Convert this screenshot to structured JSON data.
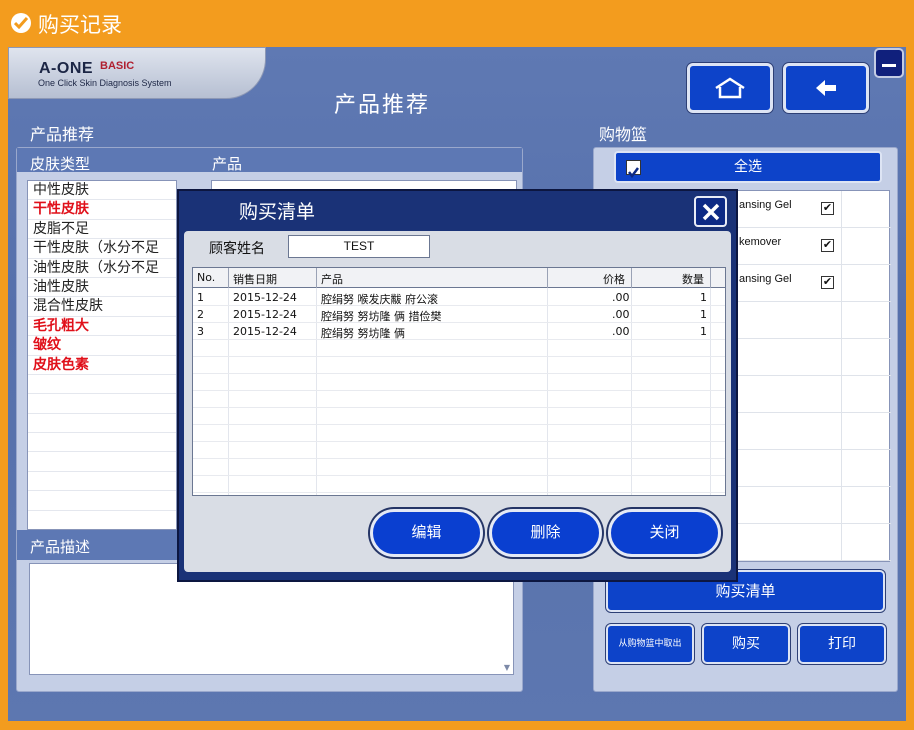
{
  "window": {
    "title": "购买记录"
  },
  "logo": {
    "main": "A-ONE",
    "basic": "BASIC",
    "sub": "One Click Skin Diagnosis System"
  },
  "page_title": "产品推荐",
  "left_panel": {
    "section_title": "产品推荐",
    "skin_type_header": "皮肤类型",
    "product_header": "产品",
    "skin_types": [
      {
        "label": "中性皮肤",
        "highlight": false
      },
      {
        "label": "干性皮肤",
        "highlight": true
      },
      {
        "label": "皮脂不足",
        "highlight": false
      },
      {
        "label": "干性皮肤（水分不足",
        "highlight": false
      },
      {
        "label": "油性皮肤（水分不足",
        "highlight": false
      },
      {
        "label": "油性皮肤",
        "highlight": false
      },
      {
        "label": "混合性皮肤",
        "highlight": false
      },
      {
        "label": "毛孔粗大",
        "highlight": true
      },
      {
        "label": "皱纹",
        "highlight": true
      },
      {
        "label": "皮肤色素",
        "highlight": true
      }
    ],
    "description_header": "产品描述"
  },
  "right_panel": {
    "section_title": "购物篮",
    "select_all": "全选",
    "cart_items": [
      {
        "name": "ansing Gel",
        "checked": "✔"
      },
      {
        "name": "kemover",
        "checked": "✔"
      },
      {
        "name": "ansing Gel",
        "checked": "✔"
      }
    ],
    "purchase_list_button": "购买清单",
    "remove_button": "从购物篮中取出",
    "buy_button": "购买",
    "print_button": "打印"
  },
  "dialog": {
    "title": "购买清单",
    "customer_label": "顾客姓名",
    "customer_value": "TEST",
    "columns": [
      "No.",
      "销售日期",
      "产品",
      "价格",
      "数量"
    ],
    "rows": [
      {
        "no": "1",
        "date": "2015-12-24",
        "product": "腔绢努 喉发庆黻 府公滚",
        "price": ".00",
        "qty": "1"
      },
      {
        "no": "2",
        "date": "2015-12-24",
        "product": "腔绢努 努坊隆 俩 措俭樊",
        "price": ".00",
        "qty": "1"
      },
      {
        "no": "3",
        "date": "2015-12-24",
        "product": "腔绢努 努坊隆 俩",
        "price": ".00",
        "qty": "1"
      }
    ],
    "edit_button": "编辑",
    "delete_button": "删除",
    "close_button": "关闭"
  }
}
